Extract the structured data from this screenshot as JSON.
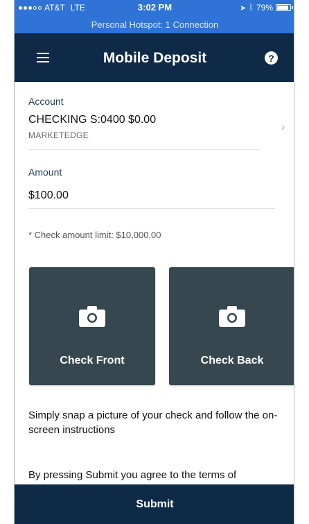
{
  "status_bar": {
    "carrier": "AT&T",
    "network": "LTE",
    "time": "3:02 PM",
    "battery": "79%",
    "battery_level": 0.79,
    "hotspot": "Personal Hotspot: 1 Connection"
  },
  "header": {
    "title": "Mobile Deposit",
    "menu_icon": "hamburger-menu-icon",
    "help_icon": "question-circle-icon",
    "help_symbol": "?"
  },
  "account": {
    "label": "Account",
    "value": "CHECKING S:0400 $0.00",
    "sub": "MARKETEDGE",
    "chevron": "›"
  },
  "amount": {
    "label": "Amount",
    "value": "$100.00"
  },
  "limit_note": "* Check amount limit: $10,000.00",
  "check_front": {
    "label": "Check Front",
    "icon": "camera-icon"
  },
  "check_back": {
    "label": "Check Back",
    "icon": "camera-icon"
  },
  "instructions": "Simply snap a picture of your check and follow the on-screen instructions",
  "terms_partial": "By pressing Submit you agree to the terms of",
  "submit_label": "Submit",
  "colors": {
    "status_bar": "#2f73d6",
    "navbar": "#0e2a47",
    "tile": "#37474f"
  }
}
